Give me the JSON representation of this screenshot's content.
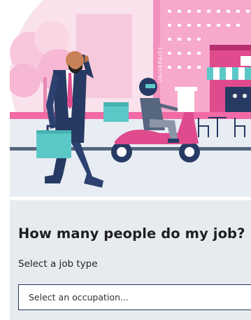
{
  "illustration": {
    "building_sign": "UNIVERSITY",
    "colors": {
      "sky": "#f7dbe8",
      "pink_light": "#f4b8d3",
      "pink_mid": "#f48cbf",
      "magenta": "#e0468f",
      "road": "#dfe5ec",
      "teal": "#5bc8c8",
      "navy": "#273a63"
    }
  },
  "occupation_tool": {
    "heading": "How many people do my job?",
    "label": "Select a job type",
    "select": {
      "placeholder": "Select an occupation..."
    }
  }
}
